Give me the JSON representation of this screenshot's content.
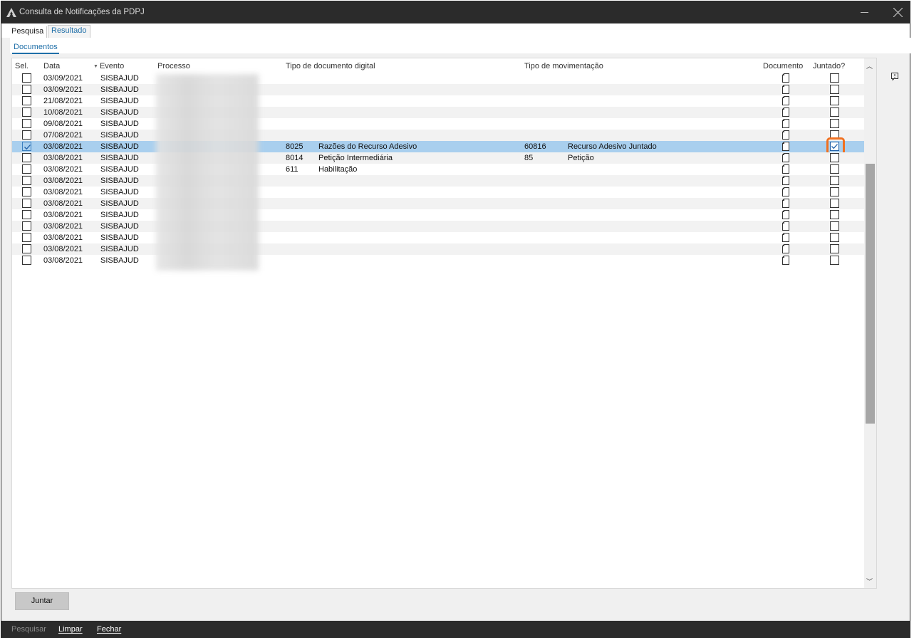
{
  "window": {
    "title": "Consulta de Notificações da PDPJ"
  },
  "tabs": [
    {
      "label": "Pesquisa"
    },
    {
      "label": "Resultado"
    }
  ],
  "subtab": {
    "label": "Documentos"
  },
  "grid": {
    "headers": {
      "sel": "Sel.",
      "data": "Data",
      "evento": "Evento",
      "processo": "Processo",
      "tipo_doc": "Tipo de documento digital",
      "tipo_mov": "Tipo de movimentação",
      "documento": "Documento",
      "juntado": "Juntado?"
    },
    "rows": [
      {
        "data": "03/09/2021",
        "evento": "SISBAJUD",
        "doc_code": "",
        "doc_name": "",
        "mov_code": "",
        "mov_name": "",
        "sel": false,
        "juntado": false
      },
      {
        "data": "03/09/2021",
        "evento": "SISBAJUD",
        "doc_code": "",
        "doc_name": "",
        "mov_code": "",
        "mov_name": "",
        "sel": false,
        "juntado": false
      },
      {
        "data": "21/08/2021",
        "evento": "SISBAJUD",
        "doc_code": "",
        "doc_name": "",
        "mov_code": "",
        "mov_name": "",
        "sel": false,
        "juntado": false
      },
      {
        "data": "10/08/2021",
        "evento": "SISBAJUD",
        "doc_code": "",
        "doc_name": "",
        "mov_code": "",
        "mov_name": "",
        "sel": false,
        "juntado": false
      },
      {
        "data": "09/08/2021",
        "evento": "SISBAJUD",
        "doc_code": "",
        "doc_name": "",
        "mov_code": "",
        "mov_name": "",
        "sel": false,
        "juntado": false
      },
      {
        "data": "07/08/2021",
        "evento": "SISBAJUD",
        "doc_code": "",
        "doc_name": "",
        "mov_code": "",
        "mov_name": "",
        "sel": false,
        "juntado": false
      },
      {
        "data": "03/08/2021",
        "evento": "SISBAJUD",
        "doc_code": "8025",
        "doc_name": "Razões do Recurso Adesivo",
        "mov_code": "60816",
        "mov_name": "Recurso Adesivo Juntado",
        "sel": true,
        "juntado": true
      },
      {
        "data": "03/08/2021",
        "evento": "SISBAJUD",
        "doc_code": "8014",
        "doc_name": "Petição Intermediária",
        "mov_code": "85",
        "mov_name": "Petição",
        "sel": false,
        "juntado": false
      },
      {
        "data": "03/08/2021",
        "evento": "SISBAJUD",
        "doc_code": "611",
        "doc_name": "Habilitação",
        "mov_code": "",
        "mov_name": "",
        "sel": false,
        "juntado": false
      },
      {
        "data": "03/08/2021",
        "evento": "SISBAJUD",
        "doc_code": "",
        "doc_name": "",
        "mov_code": "",
        "mov_name": "",
        "sel": false,
        "juntado": false
      },
      {
        "data": "03/08/2021",
        "evento": "SISBAJUD",
        "doc_code": "",
        "doc_name": "",
        "mov_code": "",
        "mov_name": "",
        "sel": false,
        "juntado": false
      },
      {
        "data": "03/08/2021",
        "evento": "SISBAJUD",
        "doc_code": "",
        "doc_name": "",
        "mov_code": "",
        "mov_name": "",
        "sel": false,
        "juntado": false
      },
      {
        "data": "03/08/2021",
        "evento": "SISBAJUD",
        "doc_code": "",
        "doc_name": "",
        "mov_code": "",
        "mov_name": "",
        "sel": false,
        "juntado": false
      },
      {
        "data": "03/08/2021",
        "evento": "SISBAJUD",
        "doc_code": "",
        "doc_name": "",
        "mov_code": "",
        "mov_name": "",
        "sel": false,
        "juntado": false
      },
      {
        "data": "03/08/2021",
        "evento": "SISBAJUD",
        "doc_code": "",
        "doc_name": "",
        "mov_code": "",
        "mov_name": "",
        "sel": false,
        "juntado": false
      },
      {
        "data": "03/08/2021",
        "evento": "SISBAJUD",
        "doc_code": "",
        "doc_name": "",
        "mov_code": "",
        "mov_name": "",
        "sel": false,
        "juntado": false
      },
      {
        "data": "03/08/2021",
        "evento": "SISBAJUD",
        "doc_code": "",
        "doc_name": "",
        "mov_code": "",
        "mov_name": "",
        "sel": false,
        "juntado": false
      }
    ]
  },
  "actions": {
    "juntar": "Juntar"
  },
  "bottombar": {
    "pesquisar": "Pesquisar",
    "limpar": "Limpar",
    "fechar": "Fechar"
  },
  "colors": {
    "selected_row": "#a9cfee",
    "highlight": "#f07020",
    "accent": "#1f6fa8",
    "titlebar": "#2b2b2b"
  }
}
